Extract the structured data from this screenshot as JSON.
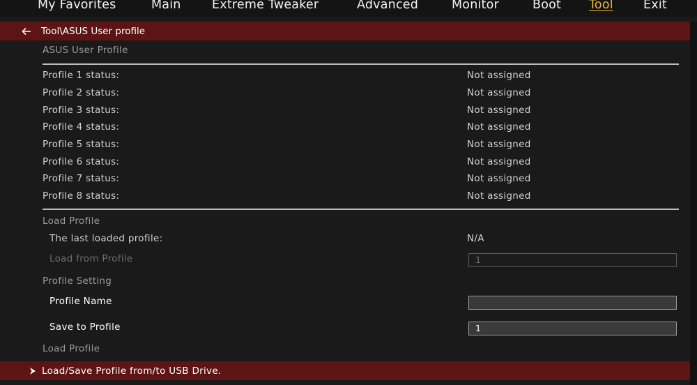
{
  "nav": {
    "tabs": [
      {
        "label": "My Favorites"
      },
      {
        "label": "Main"
      },
      {
        "label": "Extreme Tweaker"
      },
      {
        "label": "Advanced"
      },
      {
        "label": "Monitor"
      },
      {
        "label": "Boot"
      },
      {
        "label": "Tool",
        "active": true
      },
      {
        "label": "Exit"
      }
    ]
  },
  "breadcrumb": "Tool\\ASUS User profile",
  "section_title": "ASUS User Profile",
  "profiles": [
    {
      "label": "Profile 1 status:",
      "value": "Not assigned"
    },
    {
      "label": "Profile 2 status:",
      "value": "Not assigned"
    },
    {
      "label": "Profile 3 status:",
      "value": "Not assigned"
    },
    {
      "label": "Profile 4 status:",
      "value": "Not assigned"
    },
    {
      "label": "Profile 5 status:",
      "value": "Not assigned"
    },
    {
      "label": "Profile 6 status:",
      "value": "Not assigned"
    },
    {
      "label": "Profile 7 status:",
      "value": "Not assigned"
    },
    {
      "label": "Profile 8 status:",
      "value": "Not assigned"
    }
  ],
  "load_section": {
    "title": "Load Profile",
    "last_loaded_label": "The last loaded profile:",
    "last_loaded_value": "N/A",
    "load_from_label": "Load from Profile",
    "load_from_value": "1"
  },
  "setting_section": {
    "title": "Profile Setting",
    "name_label": "Profile Name",
    "name_value": "",
    "save_label": "Save to Profile",
    "save_value": "1"
  },
  "load_profile_link": "Load Profile",
  "usb_link": "Load/Save Profile from/to USB Drive.",
  "colors": {
    "accent": "#e8b43a",
    "bar": "#5c1414",
    "background": "#1a1a1a"
  },
  "icons": {
    "back": "back-arrow-icon",
    "submenu": "chevron-right-icon"
  }
}
